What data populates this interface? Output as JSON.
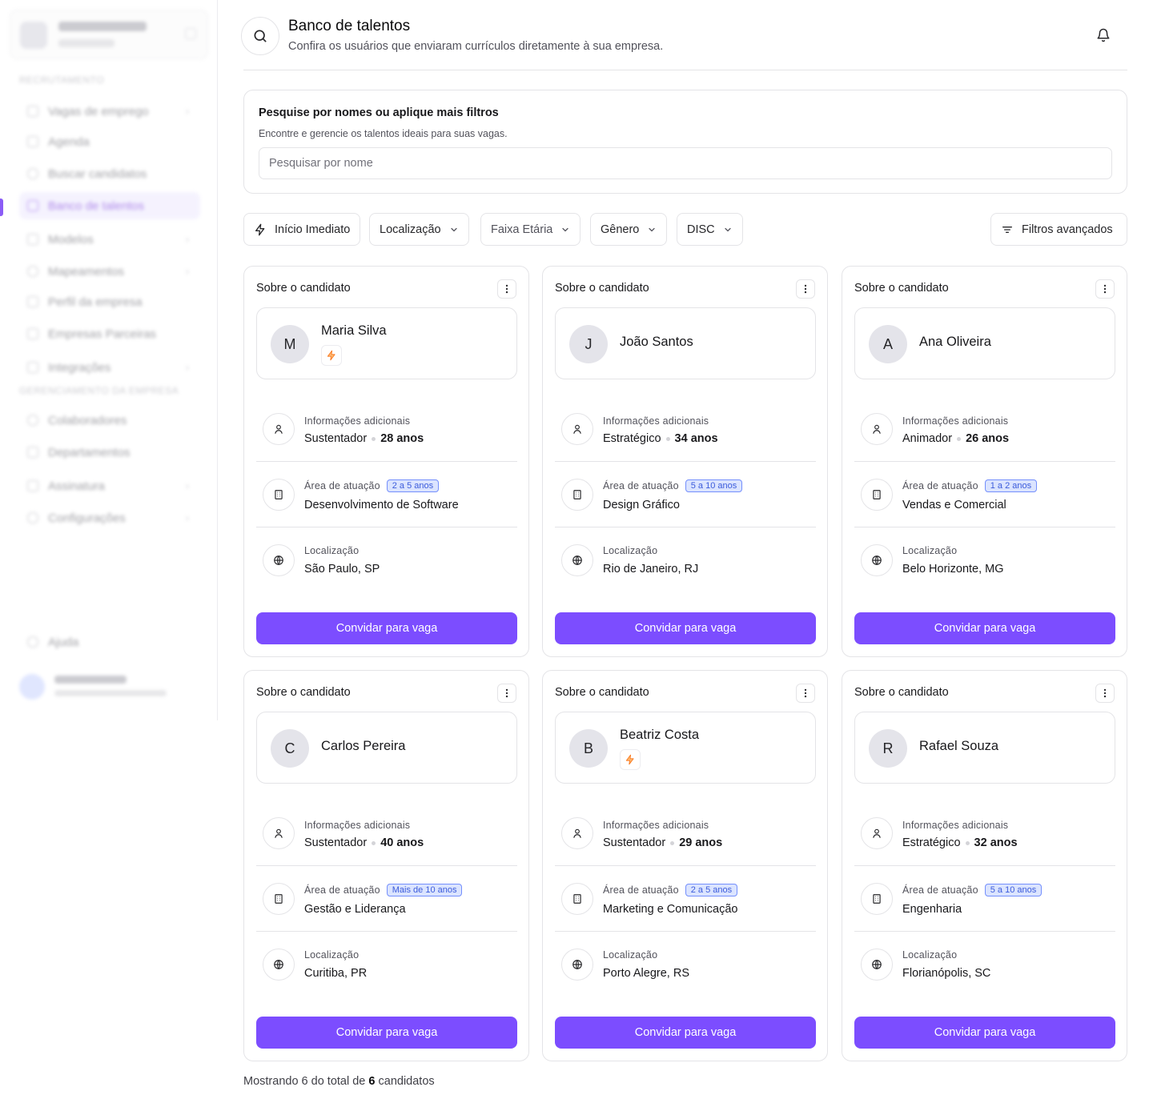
{
  "header": {
    "title": "Banco de talentos",
    "subtitle": "Confira os usuários que enviaram currículos diretamente à sua empresa."
  },
  "search_panel": {
    "title": "Pesquise por nomes ou aplique mais filtros",
    "subtitle": "Encontre e gerencie os talentos ideais para suas vagas.",
    "placeholder": "Pesquisar por nome"
  },
  "filters": {
    "immediate": "Início Imediato",
    "location": "Localização",
    "age": "Faixa Etária",
    "gender": "Gênero",
    "disc": "DISC",
    "advanced": "Filtros avançados"
  },
  "sidebar": {
    "section_recruitment": "RECRUTAMENTO",
    "section_management": "GERENCIAMENTO DA EMPRESA",
    "items": [
      {
        "label": "Vagas de emprego"
      },
      {
        "label": "Agenda"
      },
      {
        "label": "Buscar candidatos"
      },
      {
        "label": "Banco de talentos"
      },
      {
        "label": "Modelos"
      },
      {
        "label": "Mapeamentos"
      },
      {
        "label": "Perfil da empresa"
      },
      {
        "label": "Empresas Parceiras"
      },
      {
        "label": "Integrações"
      },
      {
        "label": "Colaboradores"
      },
      {
        "label": "Departamentos"
      },
      {
        "label": "Assinatura"
      },
      {
        "label": "Configurações"
      },
      {
        "label": "Ajuda"
      }
    ]
  },
  "card_labels": {
    "about": "Sobre o candidato",
    "additional": "Informações adicionais",
    "area": "Área de atuação",
    "location": "Localização",
    "invite": "Convidar para vaga"
  },
  "candidates": [
    {
      "initial": "M",
      "name": "Maria Silva",
      "immediate": true,
      "profile": "Sustentador",
      "age": "28 anos",
      "experience": "2 a 5 anos",
      "area": "Desenvolvimento de Software",
      "location": "São Paulo, SP"
    },
    {
      "initial": "J",
      "name": "João Santos",
      "immediate": false,
      "profile": "Estratégico",
      "age": "34 anos",
      "experience": "5 a 10 anos",
      "area": "Design Gráfico",
      "location": "Rio de Janeiro, RJ"
    },
    {
      "initial": "A",
      "name": "Ana Oliveira",
      "immediate": false,
      "profile": "Animador",
      "age": "26 anos",
      "experience": "1 a 2 anos",
      "area": "Vendas e Comercial",
      "location": "Belo Horizonte, MG"
    },
    {
      "initial": "C",
      "name": "Carlos Pereira",
      "immediate": false,
      "profile": "Sustentador",
      "age": "40 anos",
      "experience": "Mais de 10 anos",
      "area": "Gestão e Liderança",
      "location": "Curitiba, PR"
    },
    {
      "initial": "B",
      "name": "Beatriz Costa",
      "immediate": true,
      "profile": "Sustentador",
      "age": "29 anos",
      "experience": "2 a 5 anos",
      "area": "Marketing e Comunicação",
      "location": "Porto Alegre, RS"
    },
    {
      "initial": "R",
      "name": "Rafael Souza",
      "immediate": false,
      "profile": "Estratégico",
      "age": "32 anos",
      "experience": "5 a 10 anos",
      "area": "Engenharia",
      "location": "Florianópolis, SC"
    }
  ],
  "footer": {
    "prefix": "Mostrando 6 do total de",
    "total": "6",
    "suffix": "candidatos"
  },
  "colors": {
    "primary": "#7c4dff",
    "badge_bg": "#dbe4ff",
    "badge_text": "#3b5bdb",
    "bolt": "#f97316"
  }
}
